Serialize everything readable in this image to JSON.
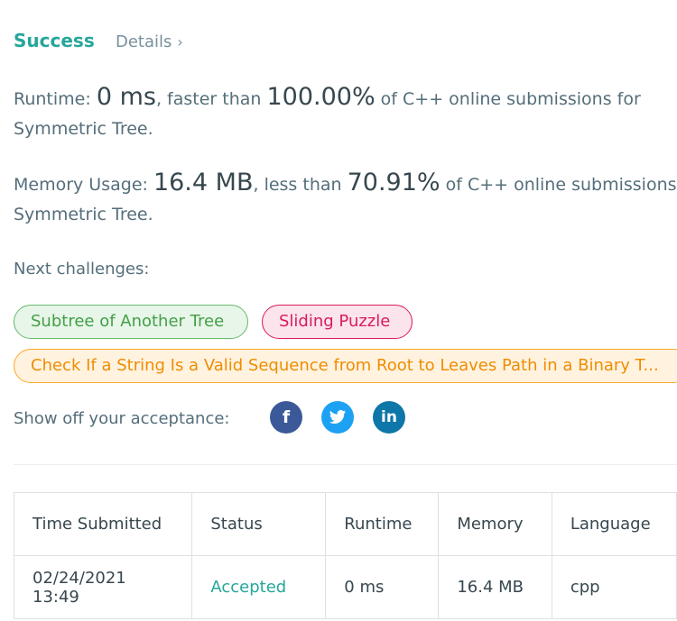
{
  "header": {
    "status": "Success",
    "details_label": "Details",
    "chevron": "›"
  },
  "runtime": {
    "label": "Runtime: ",
    "value": "0 ms",
    "mid_text": ", faster than ",
    "percent": "100.00%",
    "suffix": " of C++ online submissions for",
    "problem": "Symmetric Tree."
  },
  "memory": {
    "label": "Memory Usage: ",
    "value": "16.4 MB",
    "mid_text": ", less than ",
    "percent": "70.91%",
    "suffix": " of C++ online submissions for",
    "problem": "Symmetric Tree."
  },
  "next": {
    "label": "Next challenges:",
    "challenges": [
      "Subtree of Another Tree",
      "Sliding Puzzle",
      "Check If a String Is a Valid Sequence from Root to Leaves Path in a Binary T..."
    ]
  },
  "share": {
    "label": "Show off your acceptance:",
    "icons": [
      "facebook-icon",
      "twitter-icon",
      "linkedin-icon"
    ]
  },
  "table": {
    "headers": [
      "Time Submitted",
      "Status",
      "Runtime",
      "Memory",
      "Language"
    ],
    "rows": [
      [
        "02/24/2021 13:49",
        "Accepted",
        "0 ms",
        "16.4 MB",
        "cpp"
      ]
    ]
  },
  "colors": {
    "success": "#26a69a",
    "easy": "#43a047",
    "hard": "#d81b60",
    "medium": "#f08c00"
  }
}
